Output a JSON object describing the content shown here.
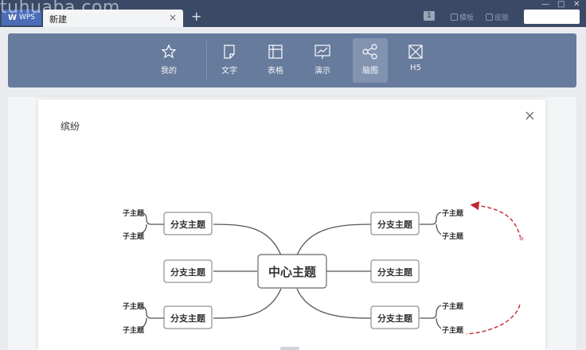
{
  "titlebar": {
    "watermark": "tuhuaba.com",
    "app_label": "WPS",
    "tab_label": "新建",
    "tab_close": "×",
    "new_tab": "+",
    "badge_count": "1",
    "template_label": "模板",
    "skin_label": "皮肤",
    "win_min": "—",
    "win_max": "□",
    "win_close": "✕"
  },
  "ribbon": {
    "items": [
      {
        "label": "我的",
        "icon": "star-icon"
      },
      {
        "label": "文字",
        "icon": "document-icon"
      },
      {
        "label": "表格",
        "icon": "table-icon"
      },
      {
        "label": "演示",
        "icon": "presentation-icon"
      },
      {
        "label": "脑图",
        "icon": "mindmap-icon"
      },
      {
        "label": "H5",
        "icon": "h5-icon"
      }
    ],
    "active_index": 4
  },
  "dialog": {
    "title": "缤纷",
    "close": "×"
  },
  "mindmap": {
    "center": "中心主题",
    "branches": [
      "分支主题",
      "分支主题",
      "分支主题",
      "分支主题",
      "分支主题",
      "分支主题"
    ],
    "subtopics": [
      "子主题",
      "子主题",
      "子主题",
      "子主题",
      "子主题",
      "子主题",
      "子主题",
      "子主题"
    ],
    "line_color": "#555555",
    "arrow_color": "#c0272d"
  }
}
